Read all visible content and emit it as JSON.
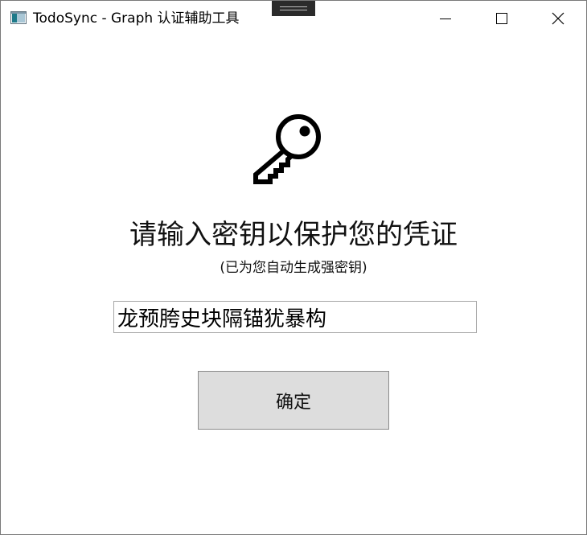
{
  "window": {
    "title": "TodoSync - Graph 认证辅助工具"
  },
  "prompt": {
    "title": "请输入密钥以保护您的凭证",
    "subtitle": "(已为您自动生成强密钥)"
  },
  "key_field": {
    "value": "龙预胯史块隔锚犹暴构"
  },
  "actions": {
    "confirm_label": "确定"
  },
  "icons": {
    "app": "app-window-icon",
    "key": "key-icon",
    "minimize": "minimize-icon",
    "maximize": "maximize-icon",
    "close": "close-icon"
  }
}
